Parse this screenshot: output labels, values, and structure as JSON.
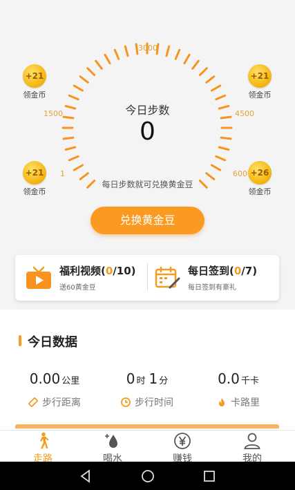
{
  "gauge": {
    "ticks": {
      "t3000": "3000",
      "t1500": "1500",
      "t4500": "4500",
      "t1": "1",
      "t600": "600"
    },
    "title": "今日步数",
    "value": "0",
    "note": "每日步数就可兑换黄金豆",
    "exchange_button": "兑换黄金豆"
  },
  "coins": [
    {
      "amount": "+21",
      "label": "领金币"
    },
    {
      "amount": "+21",
      "label": "领金币"
    },
    {
      "amount": "+21",
      "label": "领金币"
    },
    {
      "amount": "+26",
      "label": "领金币"
    }
  ],
  "tasks": {
    "video": {
      "title_prefix": "福利视频(",
      "done": "0",
      "total": "/10)",
      "sub": "送60黄金豆"
    },
    "sign": {
      "title_prefix": "每日签到(",
      "done": "0",
      "total": "/7)",
      "sub": "每日签到有豪礼"
    }
  },
  "today": {
    "section_title": "今日数据",
    "distance": {
      "value": "0.00",
      "unit": "公里",
      "label": "步行距离"
    },
    "time": {
      "hours": "0",
      "hours_unit": "时",
      "minutes": "1",
      "minutes_unit": "分",
      "label": "步行时间"
    },
    "calories": {
      "value": "0.0",
      "unit": "千卡",
      "label": "卡路里"
    }
  },
  "tabs": [
    {
      "label": "走路",
      "active": true
    },
    {
      "label": "喝水"
    },
    {
      "label": "赚钱"
    },
    {
      "label": "我的"
    }
  ],
  "colors": {
    "accent": "#fb9a22",
    "coin": "#f6b916"
  },
  "icons": [
    "tv-icon",
    "calendar-pen-icon",
    "ruler-icon",
    "clock-icon",
    "flame-icon",
    "walking-icon",
    "water-drop-icon",
    "yen-coin-icon",
    "user-icon",
    "back-icon",
    "home-icon",
    "recents-icon"
  ]
}
